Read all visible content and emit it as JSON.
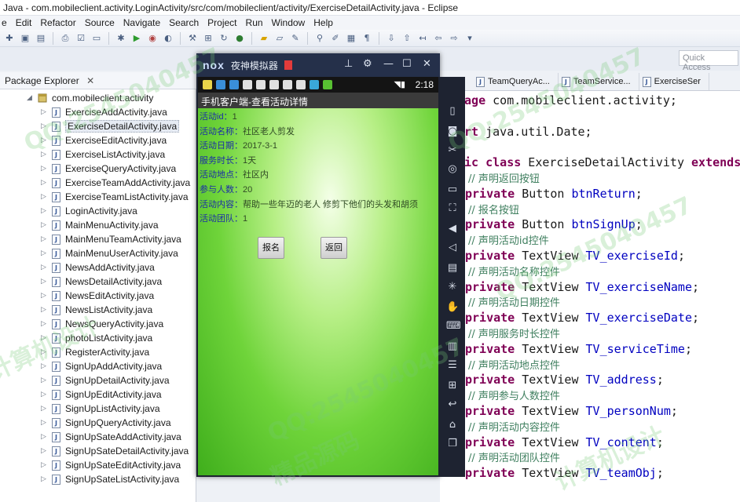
{
  "window": {
    "title": "Java - com.mobileclient.activity.LoginActivity/src/com/mobileclient/activity/ExerciseDetailActivity.java - Eclipse"
  },
  "menu": [
    "e",
    "Edit",
    "Refactor",
    "Source",
    "Navigate",
    "Search",
    "Project",
    "Run",
    "Window",
    "Help"
  ],
  "quick_access": {
    "placeholder": "Quick Access"
  },
  "explorer": {
    "tab_label": "Package Explorer",
    "close_glyph": "✕",
    "package": "com.mobileclient.activity",
    "files": [
      "ExerciseAddActivity.java",
      "ExerciseDetailActivity.java",
      "ExerciseEditActivity.java",
      "ExerciseListActivity.java",
      "ExerciseQueryActivity.java",
      "ExerciseTeamAddActivity.java",
      "ExerciseTeamListActivity.java",
      "LoginActivity.java",
      "MainMenuActivity.java",
      "MainMenuTeamActivity.java",
      "MainMenuUserActivity.java",
      "NewsAddActivity.java",
      "NewsDetailActivity.java",
      "NewsEditActivity.java",
      "NewsListActivity.java",
      "NewsQueryActivity.java",
      "photoListActivity.java",
      "RegisterActivity.java",
      "SignUpAddActivity.java",
      "SignUpDetailActivity.java",
      "SignUpEditActivity.java",
      "SignUpListActivity.java",
      "SignUpQueryActivity.java",
      "SignUpSateAddActivity.java",
      "SignUpSateDetailActivity.java",
      "SignUpSateEditActivity.java",
      "SignUpSateListActivity.java"
    ],
    "selected_file": "ExerciseDetailActivity.java"
  },
  "editor": {
    "tabs": [
      "TeamQueryAc...",
      "TeamService...",
      "ExerciseSer"
    ],
    "lines": [
      {
        "t": "kw",
        "kw": "kage",
        "rest": " com.mobileclient.activity;"
      },
      {
        "t": "blank"
      },
      {
        "t": "kw",
        "kw": "ort",
        "rest": " java.util.Date;"
      },
      {
        "t": "blank"
      },
      {
        "t": "kw",
        "kw": "lic class",
        "rest": " ExerciseDetailActivity ",
        "kw2": "extends"
      },
      {
        "t": "cmt",
        "text": "// 声明返回按钮"
      },
      {
        "t": "decl",
        "type": "Button",
        "name": "btnReturn"
      },
      {
        "t": "cmt",
        "text": "// 报名按钮"
      },
      {
        "t": "decl",
        "type": "Button",
        "name": "btnSignUp"
      },
      {
        "t": "cmt",
        "text": "// 声明活动id控件"
      },
      {
        "t": "decl",
        "type": "TextView",
        "name": "TV_exerciseId"
      },
      {
        "t": "cmt",
        "text": "// 声明活动名称控件"
      },
      {
        "t": "decl",
        "type": "TextView",
        "name": "TV_exerciseName"
      },
      {
        "t": "cmt",
        "text": "// 声明活动日期控件"
      },
      {
        "t": "decl",
        "type": "TextView",
        "name": "TV_exerciseDate"
      },
      {
        "t": "cmt",
        "text": "// 声明服务时长控件"
      },
      {
        "t": "decl",
        "type": "TextView",
        "name": "TV_serviceTime"
      },
      {
        "t": "cmt",
        "text": "// 声明活动地点控件"
      },
      {
        "t": "decl",
        "type": "TextView",
        "name": "TV_address"
      },
      {
        "t": "cmt",
        "text": "// 声明参与人数控件"
      },
      {
        "t": "decl",
        "type": "TextView",
        "name": "TV_personNum"
      },
      {
        "t": "cmt",
        "text": "// 声明活动内容控件"
      },
      {
        "t": "decl",
        "type": "TextView",
        "name": "TV_content"
      },
      {
        "t": "cmt",
        "text": "// 声明活动团队控件"
      },
      {
        "t": "decl",
        "type": "TextView",
        "name": "TV_teamObj"
      }
    ],
    "private_kw": "private"
  },
  "emulator": {
    "logo": "nox",
    "name": "夜神模拟器",
    "status_time": "2:18",
    "app_title": "手机客户端-查看活动详情",
    "fields": [
      {
        "label": "活动id：",
        "value": "1"
      },
      {
        "label": "活动名称：",
        "value": "社区老人剪发"
      },
      {
        "label": "活动日期：",
        "value": "2017-3-1"
      },
      {
        "label": "服务时长：",
        "value": "1天"
      },
      {
        "label": "活动地点：",
        "value": "社区内"
      },
      {
        "label": "参与人数：",
        "value": "20"
      },
      {
        "label": "活动内容：",
        "value": "帮助一些年迈的老人 修剪下他们的头发和胡须"
      },
      {
        "label": "活动团队：",
        "value": "1"
      }
    ],
    "buttons": {
      "signup": "报名",
      "back": "返回"
    }
  },
  "watermark": {
    "qq": "QQ:2545040457",
    "cn1": "计算机设计",
    "cn2": "精品源码"
  },
  "colors": {
    "keyword": "#7f0055",
    "field": "#0000c0",
    "comment": "#3f7f5f",
    "label_blue": "#1c2ea6",
    "nox_bg": "#25304a"
  }
}
